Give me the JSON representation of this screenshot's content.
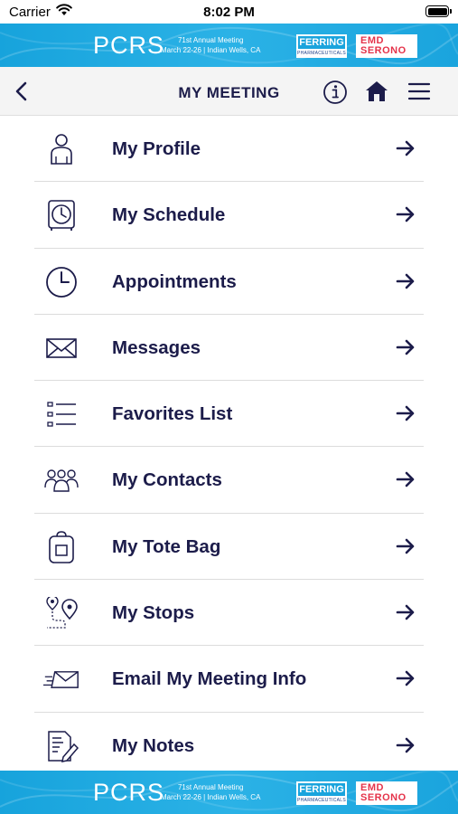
{
  "status_bar": {
    "carrier": "Carrier",
    "time": "8:02 PM"
  },
  "banner": {
    "logo": "PCRS",
    "meeting_line1": "71st Annual Meeting",
    "meeting_line2": "March 22-26 | Indian Wells, CA",
    "sponsor1_name": "FERRING",
    "sponsor1_sub": "PHARMACEUTICALS",
    "sponsor2_line1": "EMD",
    "sponsor2_line2": "SERONO",
    "background_color": "#1aa4dd"
  },
  "header": {
    "title": "MY MEETING",
    "back_icon": "chevron-left-icon",
    "info_icon": "info-icon",
    "home_icon": "home-icon",
    "menu_icon": "hamburger-icon"
  },
  "menu": {
    "items": [
      {
        "label": "My Profile",
        "icon": "person-icon"
      },
      {
        "label": "My Schedule",
        "icon": "alarm-clock-icon"
      },
      {
        "label": "Appointments",
        "icon": "clock-icon"
      },
      {
        "label": "Messages",
        "icon": "envelope-icon"
      },
      {
        "label": "Favorites List",
        "icon": "checklist-icon"
      },
      {
        "label": "My Contacts",
        "icon": "group-icon"
      },
      {
        "label": "My Tote Bag",
        "icon": "bag-icon"
      },
      {
        "label": "My Stops",
        "icon": "map-pins-icon"
      },
      {
        "label": "Email My Meeting Info",
        "icon": "send-mail-icon"
      },
      {
        "label": "My Notes",
        "icon": "notes-icon"
      }
    ]
  },
  "colors": {
    "text": "#1c1c4a",
    "header_bg": "#f4f4f4",
    "banner": "#1aa4dd",
    "emd_red": "#e5334a"
  }
}
